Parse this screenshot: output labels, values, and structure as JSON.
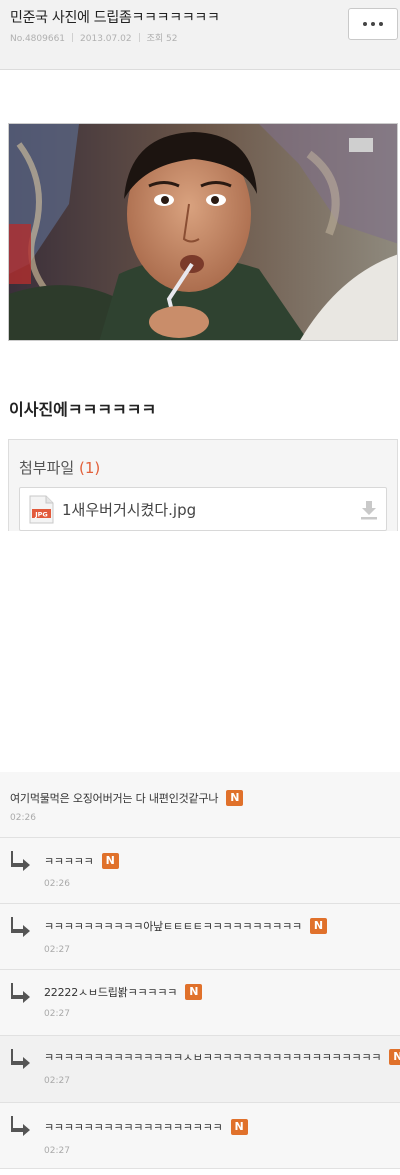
{
  "post": {
    "title": "민준국 사진에 드립좀ㅋㅋㅋㅋㅋㅋㅋ",
    "number": "No.4809661",
    "date": "2013.07.02",
    "views": "조회 52",
    "body": "이사진에ㅋㅋㅋㅋㅋㅋ"
  },
  "header": {
    "more_button": "more-options"
  },
  "attachments": {
    "label": "첨부파일",
    "count": "(1)",
    "files": [
      {
        "name": "1새우버거시켰다.jpg",
        "type": "JPG"
      }
    ]
  },
  "comments": [
    {
      "text": "여기먹물먹은 오징어버거는 다 내편인것같구나",
      "time": "02:26",
      "badge": "N",
      "reply": false
    },
    {
      "text": "ㅋㅋㅋㅋㅋ",
      "time": "02:26",
      "badge": "N",
      "reply": true
    },
    {
      "text": "ㅋㅋㅋㅋㅋㅋㅋㅋㅋㅋ아낲ㅌㅌㅌㅌㅋㅋㅋㅋㅋㅋㅋㅋㅋㅋ",
      "time": "02:27",
      "badge": "N",
      "reply": true
    },
    {
      "text": "22222ㅅㅂ드립봙ㅋㅋㅋㅋㅋ",
      "time": "02:27",
      "badge": "N",
      "reply": true
    },
    {
      "text": "ㅋㅋㅋㅋㅋㅋㅋㅋㅋㅋㅋㅋㅋㅋㅅㅂㅋㅋㅋㅋㅋㅋㅋㅋㅋㅋㅋㅋㅋㅋㅋㅋㅋㅋ",
      "time": "02:27",
      "badge": "N",
      "reply": true
    },
    {
      "text": "ㅋㅋㅋㅋㅋㅋㅋㅋㅋㅋㅋㅋㅋㅋㅋㅋㅋㅋ",
      "time": "02:27",
      "badge": "N",
      "reply": true
    }
  ],
  "colors": {
    "accent": "#e2603a",
    "badge": "#e0712b",
    "header_bg": "#f2f2f2"
  }
}
